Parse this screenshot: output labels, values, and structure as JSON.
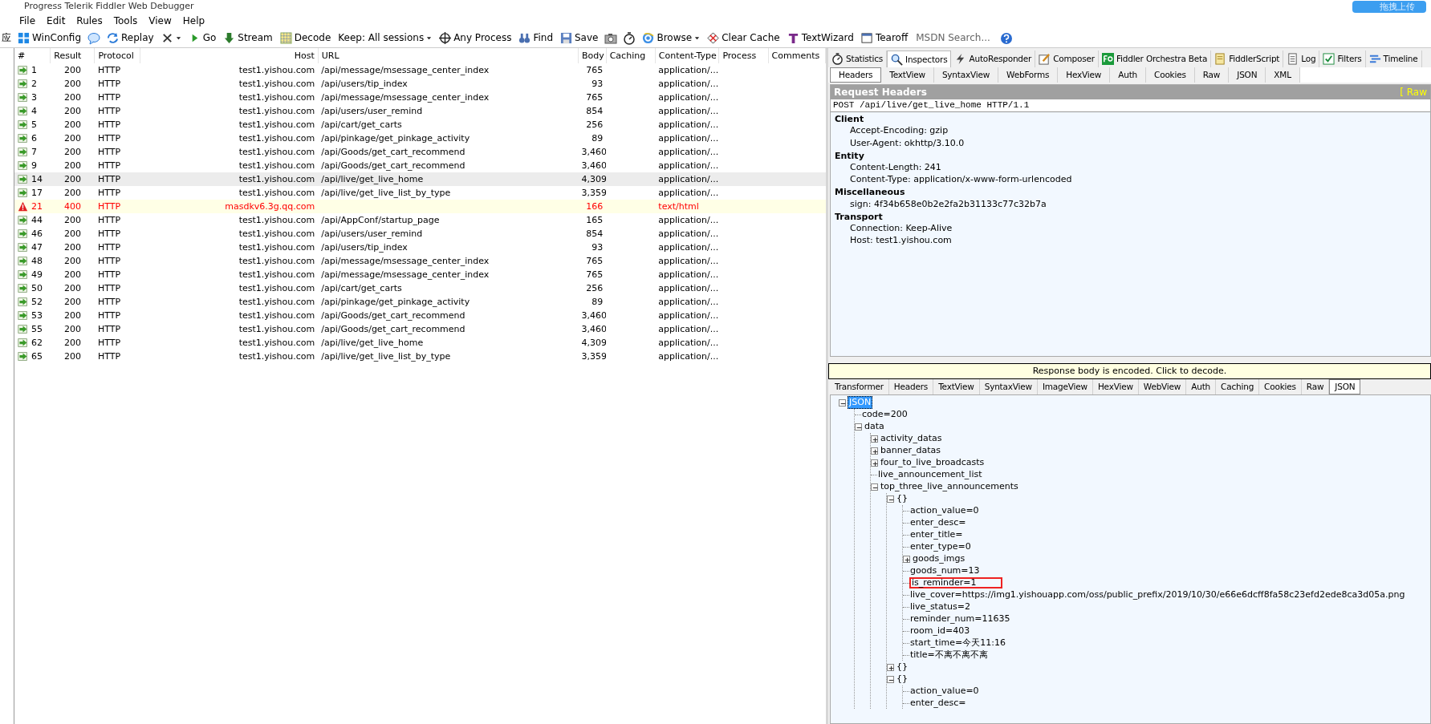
{
  "window": {
    "title": "Progress Telerik Fiddler Web Debugger",
    "upload_button": "拖拽上传"
  },
  "menu": [
    "File",
    "Edit",
    "Rules",
    "Tools",
    "View",
    "Help"
  ],
  "toolbar": {
    "cut_char": "应",
    "items": [
      {
        "kind": "button",
        "label": "WinConfig"
      },
      {
        "kind": "icon"
      },
      {
        "kind": "button",
        "label": "Replay"
      },
      {
        "kind": "dropdown"
      },
      {
        "kind": "button",
        "label": "Go"
      },
      {
        "kind": "button",
        "label": "Stream"
      },
      {
        "kind": "button",
        "label": "Decode"
      },
      {
        "kind": "dropdown",
        "label": "Keep: All sessions"
      },
      {
        "kind": "button",
        "label": "Any Process"
      },
      {
        "kind": "button",
        "label": "Find"
      },
      {
        "kind": "button",
        "label": "Save"
      },
      {
        "kind": "icon"
      },
      {
        "kind": "icon"
      },
      {
        "kind": "dropdown",
        "label": "Browse"
      },
      {
        "kind": "button",
        "label": "Clear Cache"
      },
      {
        "kind": "button",
        "label": "TextWizard"
      },
      {
        "kind": "button",
        "label": "Tearoff"
      },
      {
        "kind": "search",
        "placeholder": "MSDN Search..."
      },
      {
        "kind": "icon"
      }
    ]
  },
  "sessions": {
    "columns": [
      "#",
      "Result",
      "Protocol",
      "Host",
      "URL",
      "Body",
      "Caching",
      "Content-Type",
      "Process",
      "Comments"
    ],
    "rows": [
      {
        "kind": "ok",
        "selected": false,
        "id": "1",
        "result": "200",
        "protocol": "HTTP",
        "host": "test1.yishou.com",
        "url": "/api/message/msessage_center_index",
        "body": "765",
        "content_type": "application/..."
      },
      {
        "kind": "ok",
        "selected": false,
        "id": "2",
        "result": "200",
        "protocol": "HTTP",
        "host": "test1.yishou.com",
        "url": "/api/users/tip_index",
        "body": "93",
        "content_type": "application/..."
      },
      {
        "kind": "ok",
        "selected": false,
        "id": "3",
        "result": "200",
        "protocol": "HTTP",
        "host": "test1.yishou.com",
        "url": "/api/message/msessage_center_index",
        "body": "765",
        "content_type": "application/..."
      },
      {
        "kind": "ok",
        "selected": false,
        "id": "4",
        "result": "200",
        "protocol": "HTTP",
        "host": "test1.yishou.com",
        "url": "/api/users/user_remind",
        "body": "854",
        "content_type": "application/..."
      },
      {
        "kind": "ok",
        "selected": false,
        "id": "5",
        "result": "200",
        "protocol": "HTTP",
        "host": "test1.yishou.com",
        "url": "/api/cart/get_carts",
        "body": "256",
        "content_type": "application/..."
      },
      {
        "kind": "ok",
        "selected": false,
        "id": "6",
        "result": "200",
        "protocol": "HTTP",
        "host": "test1.yishou.com",
        "url": "/api/pinkage/get_pinkage_activity",
        "body": "89",
        "content_type": "application/..."
      },
      {
        "kind": "ok",
        "selected": false,
        "id": "7",
        "result": "200",
        "protocol": "HTTP",
        "host": "test1.yishou.com",
        "url": "/api/Goods/get_cart_recommend",
        "body": "3,460",
        "content_type": "application/..."
      },
      {
        "kind": "ok",
        "selected": false,
        "id": "9",
        "result": "200",
        "protocol": "HTTP",
        "host": "test1.yishou.com",
        "url": "/api/Goods/get_cart_recommend",
        "body": "3,460",
        "content_type": "application/..."
      },
      {
        "kind": "ok",
        "selected": true,
        "id": "14",
        "result": "200",
        "protocol": "HTTP",
        "host": "test1.yishou.com",
        "url": "/api/live/get_live_home",
        "body": "4,309",
        "content_type": "application/..."
      },
      {
        "kind": "ok",
        "selected": false,
        "id": "17",
        "result": "200",
        "protocol": "HTTP",
        "host": "test1.yishou.com",
        "url": "/api/live/get_live_list_by_type",
        "body": "3,359",
        "content_type": "application/..."
      },
      {
        "kind": "error",
        "selected": false,
        "id": "21",
        "result": "400",
        "protocol": "HTTP",
        "host": "masdkv6.3g.qq.com",
        "url": "",
        "body": "166",
        "content_type": "text/html"
      },
      {
        "kind": "ok",
        "selected": false,
        "id": "44",
        "result": "200",
        "protocol": "HTTP",
        "host": "test1.yishou.com",
        "url": "/api/AppConf/startup_page",
        "body": "165",
        "content_type": "application/..."
      },
      {
        "kind": "ok",
        "selected": false,
        "id": "46",
        "result": "200",
        "protocol": "HTTP",
        "host": "test1.yishou.com",
        "url": "/api/users/user_remind",
        "body": "854",
        "content_type": "application/..."
      },
      {
        "kind": "ok",
        "selected": false,
        "id": "47",
        "result": "200",
        "protocol": "HTTP",
        "host": "test1.yishou.com",
        "url": "/api/users/tip_index",
        "body": "93",
        "content_type": "application/..."
      },
      {
        "kind": "ok",
        "selected": false,
        "id": "48",
        "result": "200",
        "protocol": "HTTP",
        "host": "test1.yishou.com",
        "url": "/api/message/msessage_center_index",
        "body": "765",
        "content_type": "application/..."
      },
      {
        "kind": "ok",
        "selected": false,
        "id": "49",
        "result": "200",
        "protocol": "HTTP",
        "host": "test1.yishou.com",
        "url": "/api/message/msessage_center_index",
        "body": "765",
        "content_type": "application/..."
      },
      {
        "kind": "ok",
        "selected": false,
        "id": "50",
        "result": "200",
        "protocol": "HTTP",
        "host": "test1.yishou.com",
        "url": "/api/cart/get_carts",
        "body": "256",
        "content_type": "application/..."
      },
      {
        "kind": "ok",
        "selected": false,
        "id": "52",
        "result": "200",
        "protocol": "HTTP",
        "host": "test1.yishou.com",
        "url": "/api/pinkage/get_pinkage_activity",
        "body": "89",
        "content_type": "application/..."
      },
      {
        "kind": "ok",
        "selected": false,
        "id": "53",
        "result": "200",
        "protocol": "HTTP",
        "host": "test1.yishou.com",
        "url": "/api/Goods/get_cart_recommend",
        "body": "3,460",
        "content_type": "application/..."
      },
      {
        "kind": "ok",
        "selected": false,
        "id": "55",
        "result": "200",
        "protocol": "HTTP",
        "host": "test1.yishou.com",
        "url": "/api/Goods/get_cart_recommend",
        "body": "3,460",
        "content_type": "application/..."
      },
      {
        "kind": "ok",
        "selected": false,
        "id": "62",
        "result": "200",
        "protocol": "HTTP",
        "host": "test1.yishou.com",
        "url": "/api/live/get_live_home",
        "body": "4,309",
        "content_type": "application/..."
      },
      {
        "kind": "ok",
        "selected": false,
        "id": "65",
        "result": "200",
        "protocol": "HTTP",
        "host": "test1.yishou.com",
        "url": "/api/live/get_live_list_by_type",
        "body": "3,359",
        "content_type": "application/..."
      }
    ]
  },
  "main_tabs": [
    {
      "label": "Statistics",
      "selected": false
    },
    {
      "label": "Inspectors",
      "selected": true
    },
    {
      "label": "AutoResponder",
      "selected": false
    },
    {
      "label": "Composer",
      "selected": false
    },
    {
      "label": "Fiddler Orchestra Beta",
      "selected": false
    },
    {
      "label": "FiddlerScript",
      "selected": false
    },
    {
      "label": "Log",
      "selected": false
    },
    {
      "label": "Filters",
      "selected": false
    },
    {
      "label": "Timeline",
      "selected": false
    }
  ],
  "request_tabs": [
    {
      "label": "Headers",
      "selected": true
    },
    {
      "label": "TextView",
      "selected": false
    },
    {
      "label": "SyntaxView",
      "selected": false
    },
    {
      "label": "WebForms",
      "selected": false
    },
    {
      "label": "HexView",
      "selected": false
    },
    {
      "label": "Auth",
      "selected": false
    },
    {
      "label": "Cookies",
      "selected": false
    },
    {
      "label": "Raw",
      "selected": false
    },
    {
      "label": "JSON",
      "selected": false
    },
    {
      "label": "XML",
      "selected": false
    }
  ],
  "request_headers": {
    "title": "Request Headers",
    "raw_link": "[ Raw",
    "request_line": "POST /api/live/get_live_home HTTP/1.1",
    "groups": [
      {
        "name": "Client",
        "headers": [
          "Accept-Encoding: gzip",
          "User-Agent: okhttp/3.10.0"
        ]
      },
      {
        "name": "Entity",
        "headers": [
          "Content-Length: 241",
          "Content-Type: application/x-www-form-urlencoded"
        ]
      },
      {
        "name": "Miscellaneous",
        "headers": [
          "sign: 4f34b658e0b2e2fa2b31133c77c32b7a"
        ]
      },
      {
        "name": "Transport",
        "headers": [
          "Connection: Keep-Alive",
          "Host: test1.yishou.com"
        ]
      }
    ]
  },
  "response_notice": "Response body is encoded. Click to decode.",
  "response_tabs": [
    {
      "label": "Transformer",
      "selected": false
    },
    {
      "label": "Headers",
      "selected": false
    },
    {
      "label": "TextView",
      "selected": false
    },
    {
      "label": "SyntaxView",
      "selected": false
    },
    {
      "label": "ImageView",
      "selected": false
    },
    {
      "label": "HexView",
      "selected": false
    },
    {
      "label": "WebView",
      "selected": false
    },
    {
      "label": "Auth",
      "selected": false
    },
    {
      "label": "Caching",
      "selected": false
    },
    {
      "label": "Cookies",
      "selected": false
    },
    {
      "label": "Raw",
      "selected": false
    },
    {
      "label": "JSON",
      "selected": true
    }
  ],
  "json_tree": [
    {
      "label": "JSON",
      "selected": true,
      "expanded": true,
      "children": [
        {
          "label": "code=200",
          "selected": false
        },
        {
          "label": "data",
          "selected": false,
          "expanded": true,
          "children": [
            {
              "label": "activity_datas",
              "selected": false,
              "expanded": false
            },
            {
              "label": "banner_datas",
              "selected": false,
              "expanded": false
            },
            {
              "label": "four_to_live_broadcasts",
              "selected": false,
              "expanded": false
            },
            {
              "label": "live_announcement_list",
              "selected": false
            },
            {
              "label": "top_three_live_announcements",
              "selected": false,
              "expanded": true,
              "children": [
                {
                  "label": "{}",
                  "selected": false,
                  "expanded": true,
                  "children": [
                    {
                      "label": "action_value=0",
                      "selected": false
                    },
                    {
                      "label": "enter_desc=",
                      "selected": false
                    },
                    {
                      "label": "enter_title=",
                      "selected": false
                    },
                    {
                      "label": "enter_type=0",
                      "selected": false
                    },
                    {
                      "label": "goods_imgs",
                      "selected": false,
                      "expanded": false
                    },
                    {
                      "label": "goods_num=13",
                      "selected": false
                    },
                    {
                      "label": "is_reminder=1",
                      "selected": false,
                      "highlighted": true
                    },
                    {
                      "label": "live_cover=https://img1.yishouapp.com/oss/public_prefix/2019/10/30/e66e6dcff8fa58c23efd2ede8ca3d05a.png",
                      "selected": false
                    },
                    {
                      "label": "live_status=2",
                      "selected": false
                    },
                    {
                      "label": "reminder_num=11635",
                      "selected": false
                    },
                    {
                      "label": "room_id=403",
                      "selected": false
                    },
                    {
                      "label": "start_time=今天11:16",
                      "selected": false
                    },
                    {
                      "label": "title=不离不离不离",
                      "selected": false
                    }
                  ]
                },
                {
                  "label": "{}",
                  "selected": false,
                  "expanded": false
                },
                {
                  "label": "{}",
                  "selected": false,
                  "expanded": true,
                  "children": [
                    {
                      "label": "action_value=0",
                      "selected": false
                    },
                    {
                      "label": "enter_desc=",
                      "selected": false
                    }
                  ]
                }
              ]
            }
          ]
        }
      ]
    }
  ]
}
